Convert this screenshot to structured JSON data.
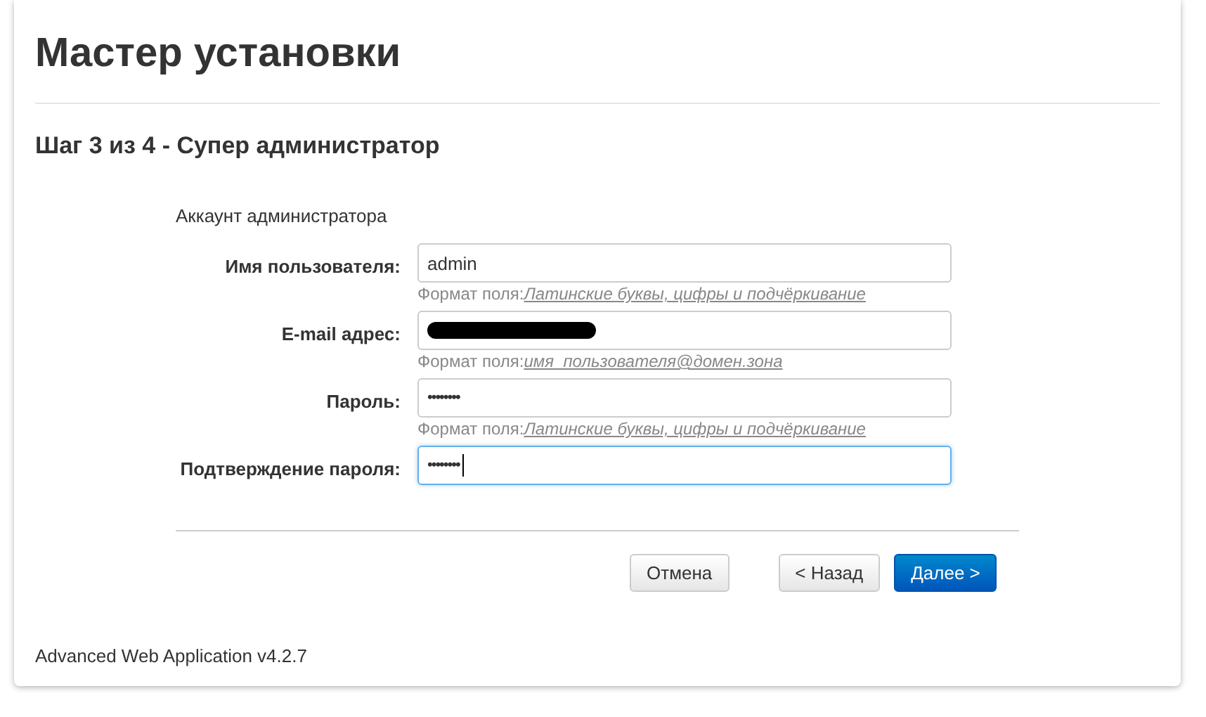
{
  "title": "Мастер установки",
  "step_title": "Шаг 3 из 4 - Супер администратор",
  "section_label": "Аккаунт администратора",
  "fields": [
    {
      "label": "Имя пользователя:",
      "kind": "text",
      "value": "admin",
      "focused": false,
      "hint_prefix": "Формат поля:",
      "hint_link": "Латинские буквы, цифры и подчёркивание"
    },
    {
      "label": "E-mail адрес:",
      "kind": "redacted",
      "focused": false,
      "hint_prefix": "Формат поля:",
      "hint_link": "имя_пользователя@домен.зона"
    },
    {
      "label": "Пароль:",
      "kind": "password",
      "value": "••••••••",
      "focused": false,
      "hint_prefix": "Формат поля:",
      "hint_link": "Латинские буквы, цифры и подчёркивание"
    },
    {
      "label": "Подтверждение пароля:",
      "kind": "password",
      "value": "••••••••",
      "focused": true
    }
  ],
  "buttons": [
    {
      "label": "Отмена",
      "kind": "default"
    },
    {
      "label": "< Назад",
      "kind": "default"
    },
    {
      "label": "Далее >",
      "kind": "primary"
    }
  ],
  "footer": "Advanced Web Application v4.2.7"
}
